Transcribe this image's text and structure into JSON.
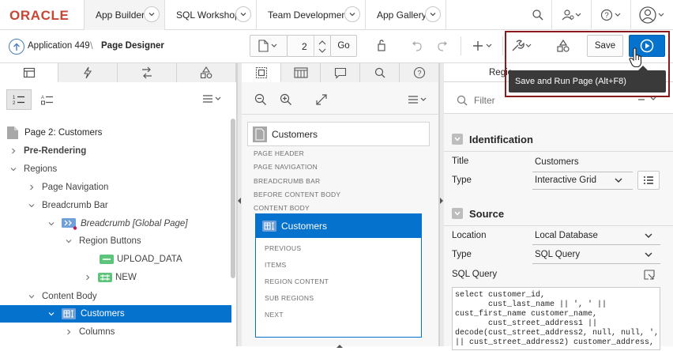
{
  "topnav": {
    "logo": "ORACLE",
    "tabs": [
      {
        "label": "App Builder"
      },
      {
        "label": "SQL Workshop"
      },
      {
        "label": "Team Development"
      },
      {
        "label": "App Gallery"
      }
    ]
  },
  "toolbar": {
    "app_label": "Application 449",
    "separator": "\\",
    "page_designer": "Page Designer",
    "page_number": "2",
    "go_label": "Go",
    "save_label": "Save"
  },
  "tooltip": {
    "text": "Save and Run Page (Alt+F8)"
  },
  "tree": {
    "root": "Page 2: Customers",
    "items": [
      {
        "label": "Pre-Rendering"
      },
      {
        "label": "Regions"
      },
      {
        "label": "Page Navigation"
      },
      {
        "label": "Breadcrumb Bar"
      },
      {
        "label": "Breadcrumb [Global Page]"
      },
      {
        "label": "Region Buttons"
      },
      {
        "label": "UPLOAD_DATA"
      },
      {
        "label": "NEW"
      },
      {
        "label": "Content Body"
      },
      {
        "label": "Customers"
      },
      {
        "label": "Columns"
      }
    ]
  },
  "layout": {
    "page_title": "Customers",
    "slots": [
      "PAGE HEADER",
      "PAGE NAVIGATION",
      "BREADCRUMB BAR",
      "BEFORE CONTENT BODY",
      "CONTENT BODY"
    ],
    "region_title": "Customers",
    "region_slots": [
      "PREVIOUS",
      "ITEMS",
      "REGION CONTENT",
      "SUB REGIONS",
      "NEXT"
    ]
  },
  "properties": {
    "tab_label": "Regio",
    "filter_placeholder": "Filter",
    "identification": {
      "heading": "Identification",
      "title_label": "Title",
      "title_value": "Customers",
      "type_label": "Type",
      "type_value": "Interactive Grid"
    },
    "source": {
      "heading": "Source",
      "location_label": "Location",
      "location_value": "Local Database",
      "type_label": "Type",
      "type_value": "SQL Query",
      "sql_label": "SQL Query",
      "sql_code": "select customer_id,\n       cust_last_name || ', ' ||\ncust_first_name customer_name,\n       cust_street_address1 ||\ndecode(cust_street_address2, null, null, ', '\n|| cust_street_address2) customer_address,"
    }
  },
  "colors": {
    "accent": "#0572ce",
    "oracle_red": "#c74634",
    "highlight_border": "#8b1a1a"
  }
}
